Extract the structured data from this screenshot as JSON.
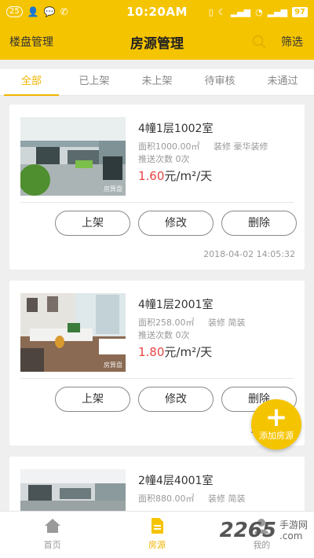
{
  "status_bar": {
    "notif_count": "25",
    "time": "10:20AM",
    "battery": "97"
  },
  "header": {
    "left_label": "楼盘管理",
    "title": "房源管理",
    "right_label": "筛选"
  },
  "tabs": [
    {
      "label": "全部",
      "active": true
    },
    {
      "label": "已上架"
    },
    {
      "label": "未上架"
    },
    {
      "label": "待审核"
    },
    {
      "label": "未通过"
    }
  ],
  "listings": [
    {
      "room": "4幢1层1002室",
      "area_label": "面积",
      "area": "1000.00㎡",
      "decoration_label": "装修",
      "decoration": "豪华装修",
      "push_label": "推送次数",
      "push_count": "0次",
      "price": "1.60",
      "price_unit": "元/m²/天",
      "watermark": "房算盘",
      "actions": {
        "publish": "上架",
        "edit": "修改",
        "delete": "删除"
      },
      "date": "2018-04-02 14:05:32"
    },
    {
      "room": "4幢1层2001室",
      "area_label": "面积",
      "area": "258.00㎡",
      "decoration_label": "装修",
      "decoration": "简装",
      "push_label": "推送次数",
      "push_count": "0次",
      "price": "1.80",
      "price_unit": "元/m²/天",
      "watermark": "房算盘",
      "actions": {
        "publish": "上架",
        "edit": "修改",
        "delete": "删除"
      },
      "date": "2018-04-0"
    },
    {
      "room": "2幢4层4001室",
      "area_label": "面积",
      "area": "880.00㎡",
      "decoration_label": "装修",
      "decoration": "简装"
    }
  ],
  "fab": {
    "label": "添加房源",
    "symbol": "+"
  },
  "bottom_nav": [
    {
      "label": "首页",
      "icon": "home-icon"
    },
    {
      "label": "房源",
      "icon": "document-icon",
      "active": true
    },
    {
      "label": "我的",
      "icon": "profile-icon"
    }
  ],
  "site_watermark": {
    "number": "2265",
    "line1": "手游网",
    "line2": ".com"
  },
  "colors": {
    "accent": "#f5c400",
    "price": "#e64545"
  }
}
